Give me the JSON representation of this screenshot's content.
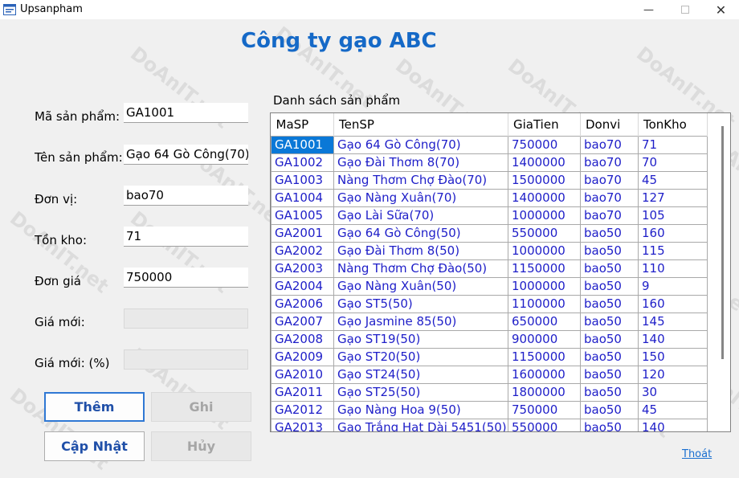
{
  "window": {
    "title": "Upsanpham",
    "icon": "app-form-icon",
    "controls": [
      "minimize-icon",
      "maximize-icon",
      "close-icon"
    ]
  },
  "heading": "Công ty gạo ABC",
  "form": {
    "ma_label": "Mã sản phẩm:",
    "ma_value": "GA1001",
    "ten_label": "Tên sản phẩm:",
    "ten_value": "Gạo 64 Gò Công(70)",
    "donvi_label": "Đơn vị:",
    "donvi_value": "bao70",
    "tonkho_label": "Tồn kho:",
    "tonkho_value": "71",
    "dongia_label": "Đơn giá",
    "dongia_value": "750000",
    "giamoi_label": "Giá mới:",
    "giamoi_value": "",
    "giamoi_pct_label": "Giá mới: (%)",
    "giamoi_pct_value": ""
  },
  "buttons": {
    "them": "Thêm",
    "ghi": "Ghi",
    "capnhat": "Cập Nhật",
    "huy": "Hủy"
  },
  "grid": {
    "label": "Danh sách sản phẩm",
    "columns": [
      "MaSP",
      "TenSP",
      "GiaTien",
      "Donvi",
      "TonKho"
    ],
    "rows": [
      [
        "GA1001",
        "Gạo 64 Gò Công(70)",
        "750000",
        "bao70",
        "71"
      ],
      [
        "GA1002",
        "Gạo Đài Thơm 8(70)",
        "1400000",
        "bao70",
        "70"
      ],
      [
        "GA1003",
        "Nàng Thơm Chợ Đào(70)",
        "1500000",
        "bao70",
        "45"
      ],
      [
        "GA1004",
        "Gạo Nàng Xuân(70)",
        "1400000",
        "bao70",
        "127"
      ],
      [
        "GA1005",
        "Gạo Lài Sữa(70)",
        "1000000",
        "bao70",
        "105"
      ],
      [
        "GA2001",
        "Gạo 64 Gò Công(50)",
        "550000",
        "bao50",
        "160"
      ],
      [
        "GA2002",
        "Gạo Đài Thơm 8(50)",
        "1000000",
        "bao50",
        "115"
      ],
      [
        "GA2003",
        "Nàng Thơm Chợ Đào(50)",
        "1150000",
        "bao50",
        "110"
      ],
      [
        "GA2004",
        "Gạo Nàng Xuân(50)",
        "1000000",
        "bao50",
        "9"
      ],
      [
        "GA2006",
        "Gạo ST5(50)",
        "1100000",
        "bao50",
        "160"
      ],
      [
        "GA2007",
        "Gạo Jasmine 85(50)",
        "650000",
        "bao50",
        "145"
      ],
      [
        "GA2008",
        "Gạo ST19(50)",
        "900000",
        "bao50",
        "140"
      ],
      [
        "GA2009",
        "Gạo ST20(50)",
        "1150000",
        "bao50",
        "150"
      ],
      [
        "GA2010",
        "Gạo ST24(50)",
        "1600000",
        "bao50",
        "120"
      ],
      [
        "GA2011",
        "Gạo ST25(50)",
        "1800000",
        "bao50",
        "30"
      ],
      [
        "GA2012",
        "Gạo Nàng Hoa 9(50)",
        "750000",
        "bao50",
        "45"
      ],
      [
        "GA2013",
        "Gạo Trắng Hạt Dài 5451(50)",
        "550000",
        "bao50",
        "140"
      ]
    ],
    "selected_index": 0
  },
  "exit_link": "Thoát",
  "watermark": "DoAnIT.net"
}
